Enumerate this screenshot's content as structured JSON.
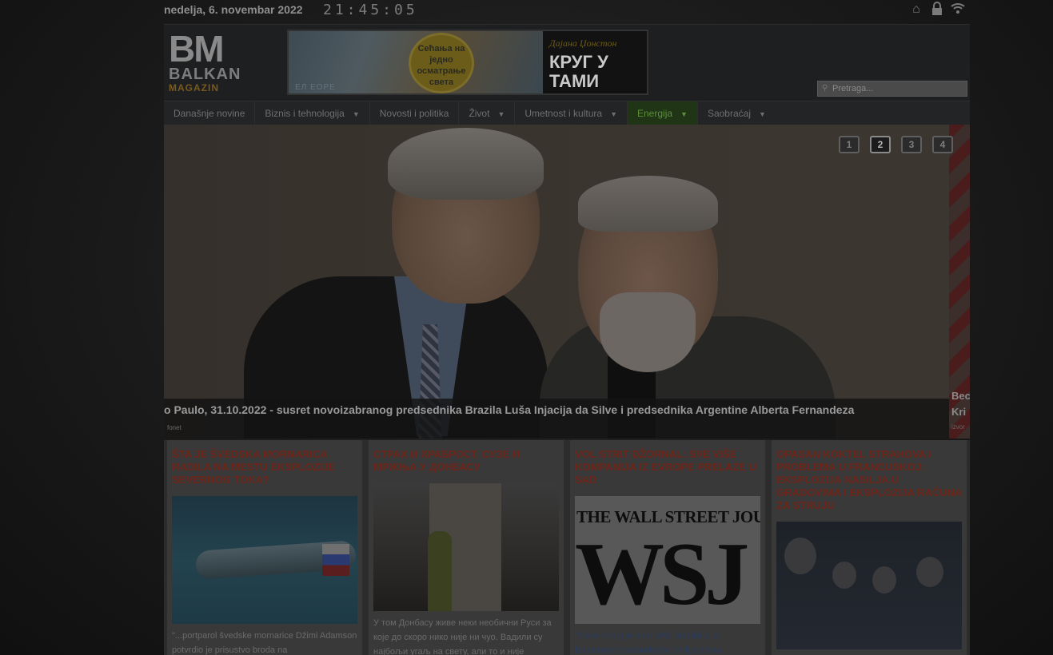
{
  "topbar": {
    "date": "nedelja, 6. novembar 2022",
    "clock": "21:45:05",
    "icons": [
      "home-icon",
      "lock-icon",
      "wifi-icon"
    ]
  },
  "header": {
    "logo": {
      "mark": "BM",
      "name": "BALKAN",
      "sub": "MAGAZIN"
    },
    "banner": {
      "circle_text": "Сећања на једно осматрање света",
      "caption": "ЕЛ ЕОРЕ",
      "author": "Дајана Џонстон",
      "title": "КРУГ У ТАМИ"
    },
    "search_placeholder": "Pretraga..."
  },
  "nav": [
    {
      "label": "Današnje novine",
      "dropdown": false,
      "active": false
    },
    {
      "label": "Biznis i tehnologija",
      "dropdown": true,
      "active": false
    },
    {
      "label": "Novosti i politika",
      "dropdown": false,
      "active": false
    },
    {
      "label": "Život",
      "dropdown": true,
      "active": false
    },
    {
      "label": "Umetnost i kultura",
      "dropdown": true,
      "active": false
    },
    {
      "label": "Energija",
      "dropdown": true,
      "active": true
    },
    {
      "label": "Saobraćaj",
      "dropdown": true,
      "active": false
    }
  ],
  "slider": {
    "caption": "o Paulo, 31.10.2022 - susret novoizabranog predsednika Brazila Luša Injacija da Silve i predsednika Argentine Alberta Fernandeza",
    "source": "fonet",
    "next_caption": "Bec Kri",
    "next_source": "izvor",
    "pages": [
      "1",
      "2",
      "3",
      "4"
    ],
    "active_page": "2"
  },
  "articles": [
    {
      "title": "ŠTA JE ŠVEDSKA MORNARICA RADILA NA MESTU EKSPLOZIJE SEVERNOG TOKA?",
      "excerpt": "\"...portparol švedske mornarice Džimi Adamson potvrdio je prisustvo broda na"
    },
    {
      "title": "СТРАХ И ХРАБРОСТ, СУЗЕ И МРЖЊА У ДОНБАСУ",
      "excerpt": "У том Донбасу живе неки необични Руси за које до скоро нико није ни чуо. Вадили су најбољи угаљ на свету, али то и није"
    },
    {
      "title": "VOL STRIT DŽORNAL: SVE VIŠE KOMPANIJA IZ EVROPE PRELAZE U SAD",
      "image_header": "THE WALL STREET JOURNAL",
      "image_logo": "WSJ",
      "excerpt": "\"Cene energije su u SAD stabilnije, a Bajdenovo predsedništvo milijardama"
    },
    {
      "title": "OPASAN KOKTEL STRAHOVA I PROBLEMA U FRANCUSKOJ: EKSPLOZIJA NASILJA U GRADOVIMA I EKSPLOZIJA RAČUNA ZA STRUJU",
      "excerpt": ""
    }
  ]
}
